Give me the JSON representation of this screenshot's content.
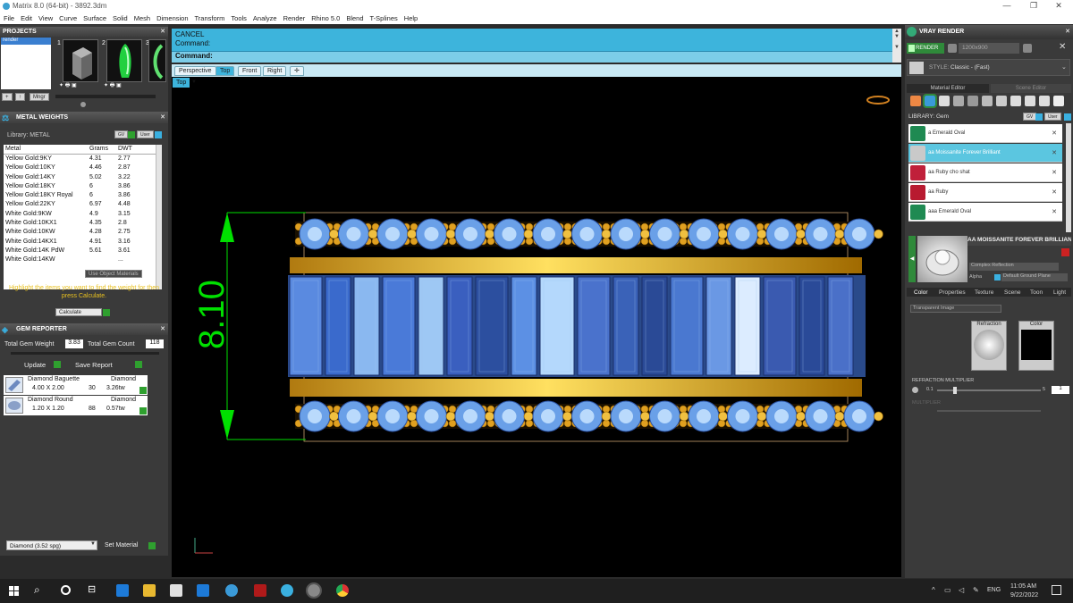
{
  "app": {
    "title": "Matrix 8.0 (64-bit) - 3892.3dm"
  },
  "menu": [
    "File",
    "Edit",
    "View",
    "Curve",
    "Surface",
    "Solid",
    "Mesh",
    "Dimension",
    "Transform",
    "Tools",
    "Analyze",
    "Render",
    "Rhino 5.0",
    "Blend",
    "T-Splines",
    "Help"
  ],
  "projects": {
    "title": "PROJECTS",
    "list_item": "render",
    "thumb_numbers": [
      "1",
      "2",
      "3"
    ],
    "mngr_label": "Mngr"
  },
  "metal_weights": {
    "title": "METAL WEIGHTS",
    "library_label": "Library: METAL",
    "gv_label": "GV",
    "user_label": "User",
    "columns": [
      "Metal",
      "Grams",
      "DWT"
    ],
    "rows": [
      [
        "Yellow Gold:9KY",
        "4.31",
        "2.77"
      ],
      [
        "Yellow Gold:10KY",
        "4.46",
        "2.87"
      ],
      [
        "Yellow Gold:14KY",
        "5.02",
        "3.22"
      ],
      [
        "Yellow Gold:18KY",
        "6",
        "3.86"
      ],
      [
        "Yellow Gold:18KY Royal",
        "6",
        "3.86"
      ],
      [
        "Yellow Gold:22KY",
        "6.97",
        "4.48"
      ],
      [
        "White Gold:9KW",
        "4.9",
        "3.15"
      ],
      [
        "White Gold:10KX1",
        "4.35",
        "2.8"
      ],
      [
        "White Gold:10KW",
        "4.28",
        "2.75"
      ],
      [
        "White Gold:14KX1",
        "4.91",
        "3.16"
      ],
      [
        "White Gold:14K PdW",
        "5.61",
        "3.61"
      ],
      [
        "White Gold:14KW",
        "",
        "..."
      ]
    ],
    "use_object_materials": "Use Object Materials",
    "instruction": "Highlight the items you want to find the weight for then press Calculate.",
    "calculate_label": "Calculate"
  },
  "gem_reporter": {
    "title": "GEM REPORTER",
    "total_weight_label": "Total Gem Weight",
    "total_weight": "3.83",
    "total_count_label": "Total Gem Count",
    "total_count": "118",
    "update_label": "Update",
    "save_report_label": "Save Report",
    "gems": [
      {
        "name": "Diamond Baguette",
        "type": "Diamond",
        "size": "4.00 X 2.00",
        "count": "30",
        "weight": "3.26tw"
      },
      {
        "name": "Diamond Round",
        "type": "Diamond",
        "size": "1.20 X 1.20",
        "count": "88",
        "weight": "0.57tw"
      }
    ],
    "material_select": "Diamond    (3.52 spg)",
    "set_material_label": "Set Material"
  },
  "command": {
    "line1": "CANCEL",
    "line2": "Command:",
    "prompt": "Command:"
  },
  "viewport_tabs": [
    "Perspective",
    "Top",
    "Front",
    "Right"
  ],
  "viewport_label": "Top",
  "dimension_value": "8.10",
  "vray": {
    "title": "VRAY RENDER",
    "render_label": "RENDER",
    "resolution": "1200x900",
    "style_label": "STYLE:",
    "style_value": "Classic - (Fast)",
    "tab_material": "Material Editor",
    "tab_scene": "Scene Editor",
    "library_label": "LIBRARY: Gem",
    "gv_label": "GV",
    "user_label": "User",
    "materials": [
      {
        "name": "a Emerald Oval",
        "color": "#1f8a52",
        "selected": false
      },
      {
        "name": "aa Moissanite Forever Brilliant",
        "color": "#c9c9c9",
        "selected": true
      },
      {
        "name": "aa Ruby cho shat",
        "color": "#c0203a",
        "selected": false
      },
      {
        "name": "aa Ruby",
        "color": "#b81a30",
        "selected": false
      },
      {
        "name": "aaa Emerald Oval",
        "color": "#1f8a52",
        "selected": false
      }
    ],
    "preview_name": "AA MOISSANITE FOREVER BRILLIANT",
    "complex_reflection": "Complex Reflection",
    "alpha_label": "Alpha",
    "ground_plane": "Default Ground Plane",
    "sub_tabs": [
      "Color",
      "Properties",
      "Texture",
      "Scene",
      "Toon",
      "Light"
    ],
    "transparent_image": "Transparent Image",
    "refraction_label": "Refraction",
    "color_label": "Color",
    "refraction_multiplier": "REFRACTION MULTIPLIER",
    "rm_min": "0.1",
    "rm_max": "5",
    "rm_value": "1",
    "multiplier2": "MULTIPLIER"
  },
  "taskbar": {
    "lang": "ENG",
    "time": "11:05 AM",
    "date": "9/22/2022"
  },
  "colors": {
    "accent_blue": "#3db4dc",
    "dimension_green": "#00e000",
    "gold": "#e0a020"
  }
}
